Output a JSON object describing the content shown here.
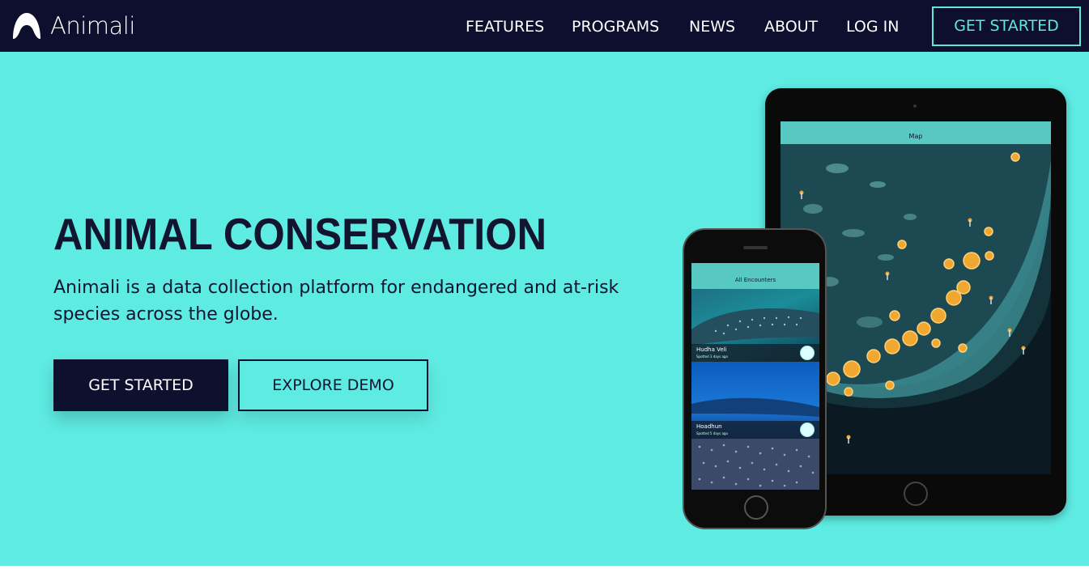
{
  "nav": {
    "brand": "Animali",
    "links": [
      "FEATURES",
      "PROGRAMS",
      "NEWS",
      "ABOUT",
      "LOG IN"
    ],
    "cta": "GET STARTED"
  },
  "hero": {
    "title": "ANIMAL CONSERVATION",
    "subtitle": "Animali is a data collection platform for endangered and at-risk species across the globe.",
    "primary_button": "GET STARTED",
    "secondary_button": "EXPLORE DEMO"
  },
  "tablet": {
    "title": "Map"
  },
  "phone": {
    "title": "All Encounters",
    "cards": [
      {
        "name": "Hudha Veli",
        "sub": "Spotted 3 days ago"
      },
      {
        "name": "Hoadhun",
        "sub": "Spotted 5 days ago"
      }
    ]
  },
  "colors": {
    "navy": "#0e0f2e",
    "aqua": "#5eebe2",
    "accent": "#5ce8e0",
    "cluster": "#f0a830"
  },
  "icons": [
    "animali-logo-icon",
    "map-pin-icon",
    "cluster-marker-icon"
  ]
}
